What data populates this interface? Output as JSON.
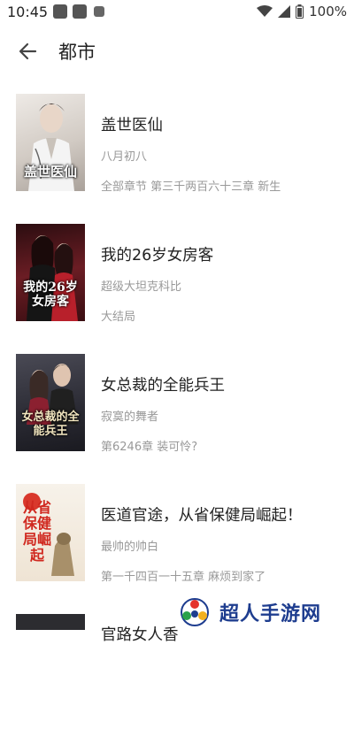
{
  "status": {
    "time": "10:45",
    "battery": "100%"
  },
  "header": {
    "title": "都市"
  },
  "books": [
    {
      "title": "盖世医仙",
      "author": "八月初八",
      "latest": "全部章节 第三千两百六十三章 新生",
      "cover_text": "盖世医仙",
      "cover_color": "#d9d4cf"
    },
    {
      "title": "我的26岁女房客",
      "author": "超级大坦克科比",
      "latest": "大结局",
      "cover_text": "我的26岁女房客",
      "cover_color": "#5a1a1f"
    },
    {
      "title": "女总裁的全能兵王",
      "author": "寂寞的舞者",
      "latest": "第6246章 装可怜?",
      "cover_text": "女总裁的全能兵王",
      "cover_color": "#3a3a44"
    },
    {
      "title": "医道官途，从省保健局崛起！",
      "author": "最帅的帅白",
      "latest": "第一千四百一十五章 麻烦到家了",
      "cover_text": "从省保健局崛起",
      "cover_color": "#f3ebe0"
    },
    {
      "title": "官路女人香",
      "author": "",
      "latest": "",
      "cover_text": "",
      "cover_color": "#2c2c30"
    }
  ],
  "watermark": {
    "text": "超人手游网"
  }
}
